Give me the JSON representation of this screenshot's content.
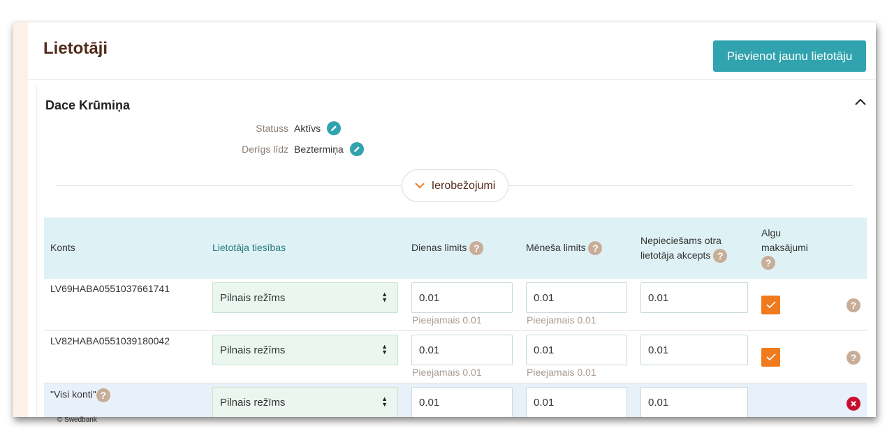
{
  "page": {
    "title": "Lietotāji",
    "add_user_label": "Pievienot jaunu lietotāju"
  },
  "user": {
    "name": "Dace Krūmiņa",
    "status_label": "Statuss",
    "status_value": "Aktīvs",
    "valid_label": "Derīgs līdz",
    "valid_value": "Beztermiņa",
    "limits_toggle_label": "Ierobežojumi"
  },
  "table": {
    "headers": {
      "account": "Konts",
      "rights": "Lietotāja tiesības",
      "daily_limit": "Dienas limits",
      "monthly_limit": "Mēneša limits",
      "second_accept": "Nepieciešams otra lietotāja akcepts",
      "salary_payments": "Algu maksājumi"
    },
    "rows": [
      {
        "account": "LV69HABA0551037661741",
        "rights": "Pilnais režīms",
        "daily_limit": "0.01",
        "daily_available": "Pieejamais 0.01",
        "monthly_limit": "0.01",
        "monthly_available": "Pieejamais 0.01",
        "second_accept": "0.01",
        "salary_checked": true
      },
      {
        "account": "LV82HABA0551039180042",
        "rights": "Pilnais režīms",
        "daily_limit": "0.01",
        "daily_available": "Pieejamais 0.01",
        "monthly_limit": "0.01",
        "monthly_available": "Pieejamais 0.01",
        "second_accept": "0.01",
        "salary_checked": true
      },
      {
        "account": "\"Visi konti\"",
        "rights": "Pilnais režīms",
        "daily_limit": "0.01",
        "monthly_limit": "0.01",
        "second_accept": "0.01"
      }
    ]
  },
  "footer": {
    "copyright": "© Swedbank"
  },
  "colors": {
    "accent": "#31a3ae",
    "title": "#512b1b",
    "header_bg": "#def1f4",
    "checkbox": "#ef7b1e",
    "remove": "#c8102e",
    "help": "#c8ad98"
  },
  "icons": {
    "collapse": "chevron-up-icon",
    "edit": "pencil-icon",
    "limits_toggle": "chevron-down-icon",
    "help": "question-mark-icon",
    "checkbox": "checkmark-icon",
    "remove": "close-circle-icon",
    "select": "sort-arrows-icon"
  }
}
